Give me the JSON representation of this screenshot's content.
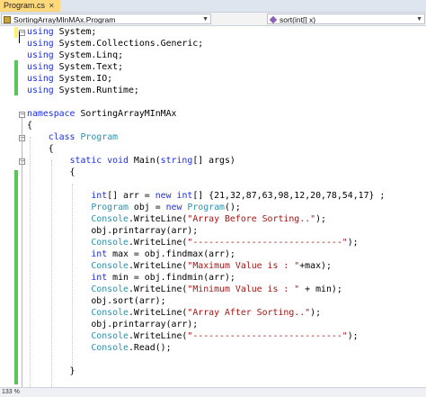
{
  "tab": {
    "title": "Program.cs",
    "close": "✕"
  },
  "nav": {
    "left": {
      "value": "SortingArrayMInMAx.Program"
    },
    "right": {
      "value": "sort(int[] x)"
    }
  },
  "code": {
    "lines": [
      [
        "using System;"
      ],
      [
        "using System.Collections.Generic;"
      ],
      [
        "using System.Linq;"
      ],
      [
        "using System.Text;"
      ],
      [
        "using System.IO;"
      ],
      [
        "using System.Runtime;"
      ],
      [
        "namespace SortingArrayMInMAx"
      ],
      [
        "{"
      ],
      [
        "    class Program"
      ],
      [
        "    {"
      ],
      [
        "        static void Main(string[] args)"
      ],
      [
        "        {"
      ],
      [
        "            int[] arr = new int[] {21,32,87,63,98,12,20,78,54,17} ;"
      ],
      [
        "            Program obj = new Program();"
      ],
      [
        "            Console.WriteLine(\"Array Before Sorting..\");"
      ],
      [
        "            obj.printarray(arr);"
      ],
      [
        "            Console.WriteLine(\"----------------------------\");"
      ],
      [
        "            int max = obj.findmax(arr);"
      ],
      [
        "            Console.WriteLine(\"Maximum Value is : \"+max);"
      ],
      [
        "            int min = obj.findmin(arr);"
      ],
      [
        "            Console.WriteLine(\"Minimum Value is : \" + min);"
      ],
      [
        "            obj.sort(arr);"
      ],
      [
        "            Console.WriteLine(\"Array After Sorting..\");"
      ],
      [
        "            obj.printarray(arr);"
      ],
      [
        "            Console.WriteLine(\"----------------------------\");"
      ],
      [
        "            Console.Read();"
      ],
      [
        "        }"
      ]
    ]
  },
  "status": {
    "zoom": "133 %"
  },
  "icons": {
    "class": "class-icon",
    "method": "method-icon"
  },
  "colors": {
    "keyword": "#1d2fe6",
    "type": "#2b91af",
    "string": "#a31515",
    "tab_active": "#ffd97a",
    "changed_saved": "#57c657",
    "changed_unsaved": "#ffef73"
  }
}
